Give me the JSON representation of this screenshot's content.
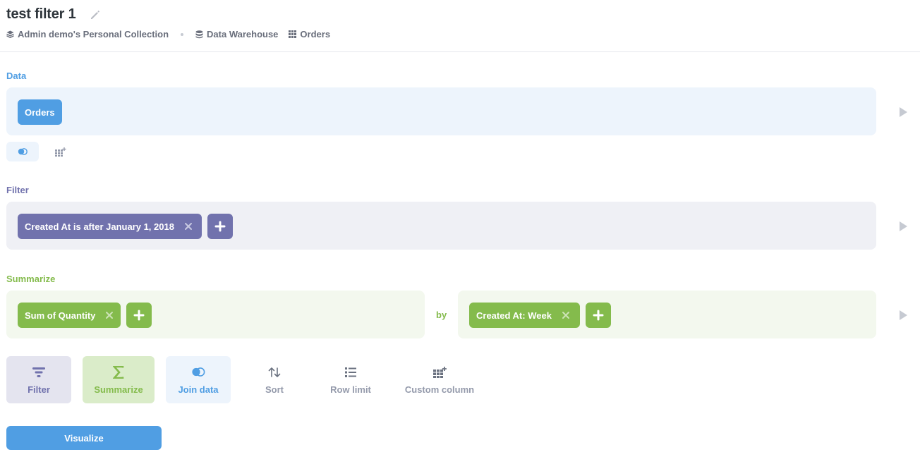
{
  "header": {
    "title": "test filter 1",
    "breadcrumbs": [
      "Admin demo's Personal Collection",
      "Data Warehouse",
      "Orders"
    ]
  },
  "data_section": {
    "label": "Data",
    "table_pill": "Orders",
    "color": "#509ee3"
  },
  "filter_section": {
    "label": "Filter",
    "filter_pill": "Created At is after January 1, 2018",
    "color": "#7172ad"
  },
  "summarize_section": {
    "label": "Summarize",
    "metric_pill": "Sum of Quantity",
    "by_label": "by",
    "breakout_pill": "Created At: Week",
    "color": "#84bb4c"
  },
  "actions": {
    "filter": "Filter",
    "summarize": "Summarize",
    "join": "Join data",
    "sort": "Sort",
    "limit": "Row limit",
    "custom": "Custom column"
  },
  "visualize_label": "Visualize"
}
